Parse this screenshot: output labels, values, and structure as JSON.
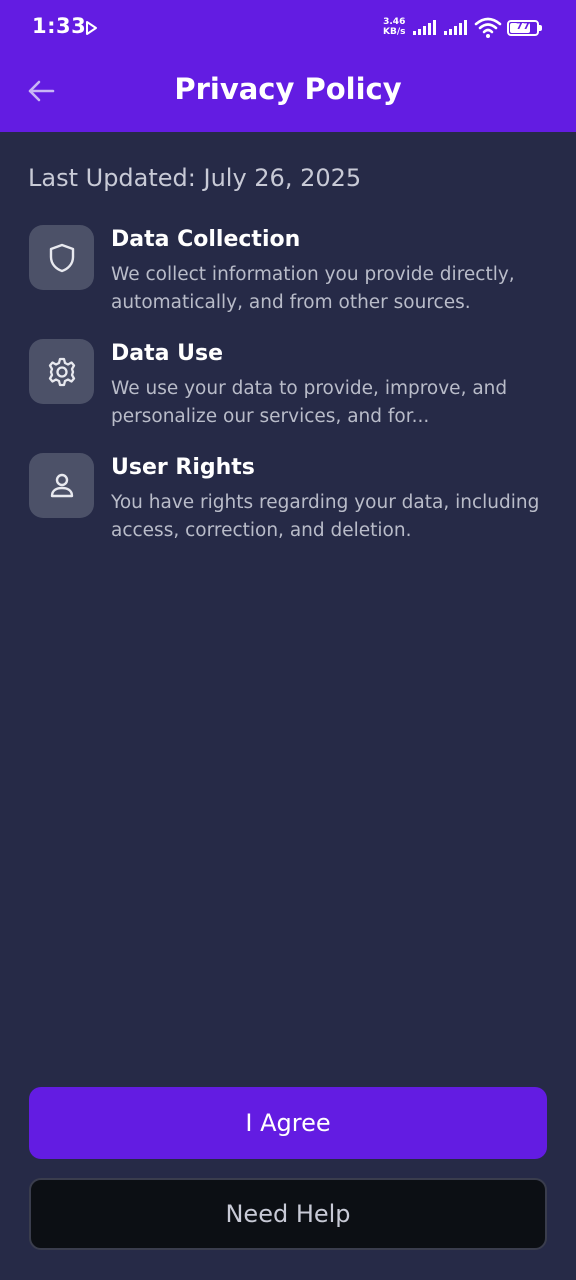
{
  "status_bar": {
    "time": "1:33",
    "net_speed_value": "3.46",
    "net_speed_unit": "KB/s",
    "battery": "77",
    "icons": [
      "play-icon",
      "signal-icon",
      "signal-icon",
      "wifi-icon",
      "battery-icon"
    ]
  },
  "header": {
    "title": "Privacy Policy",
    "back_icon": "arrow-left-icon",
    "color": "#631ce2"
  },
  "last_updated": "Last Updated: July 26, 2025",
  "items": [
    {
      "icon": "shield-icon",
      "title": "Data Collection",
      "description": "We collect information you provide directly, automatically, and from other sources."
    },
    {
      "icon": "gear-icon",
      "title": "Data Use",
      "description": "We use your data to provide, improve, and personalize our services, and for..."
    },
    {
      "icon": "user-icon",
      "title": "User Rights",
      "description": "You have rights regarding your data, including access, correction, and deletion."
    }
  ],
  "buttons": {
    "agree": "I Agree",
    "help": "Need Help"
  },
  "colors": {
    "background": "#262a47",
    "accent": "#631ce2",
    "icon_tile": "#4c5168",
    "help_button": "#0c0f14"
  }
}
